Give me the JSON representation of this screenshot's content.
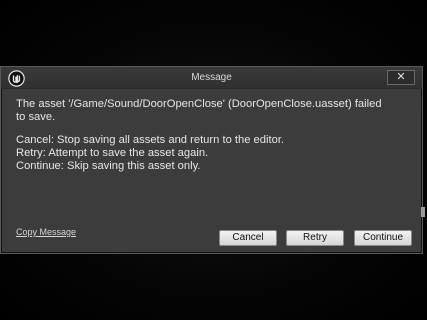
{
  "window": {
    "title": "Message",
    "close_label": "✕"
  },
  "message": {
    "line1": "The asset '/Game/Sound/DoorOpenClose' (DoorOpenClose.uasset) failed",
    "line2": "to save.",
    "option1": "Cancel: Stop saving all assets and return to the editor.",
    "option2": "Retry: Attempt to save the asset again.",
    "option3": "Continue: Skip saving this asset only."
  },
  "footer": {
    "copy_label": "Copy Message",
    "cancel_label": "Cancel",
    "retry_label": "Retry",
    "continue_label": "Continue"
  },
  "icons": {
    "logo": "unreal-logo-icon",
    "close": "close-icon"
  },
  "colors": {
    "dialog_bg": "#3c3c3c",
    "text": "#e6e6e6",
    "button_bg": "#e6e6e6"
  }
}
